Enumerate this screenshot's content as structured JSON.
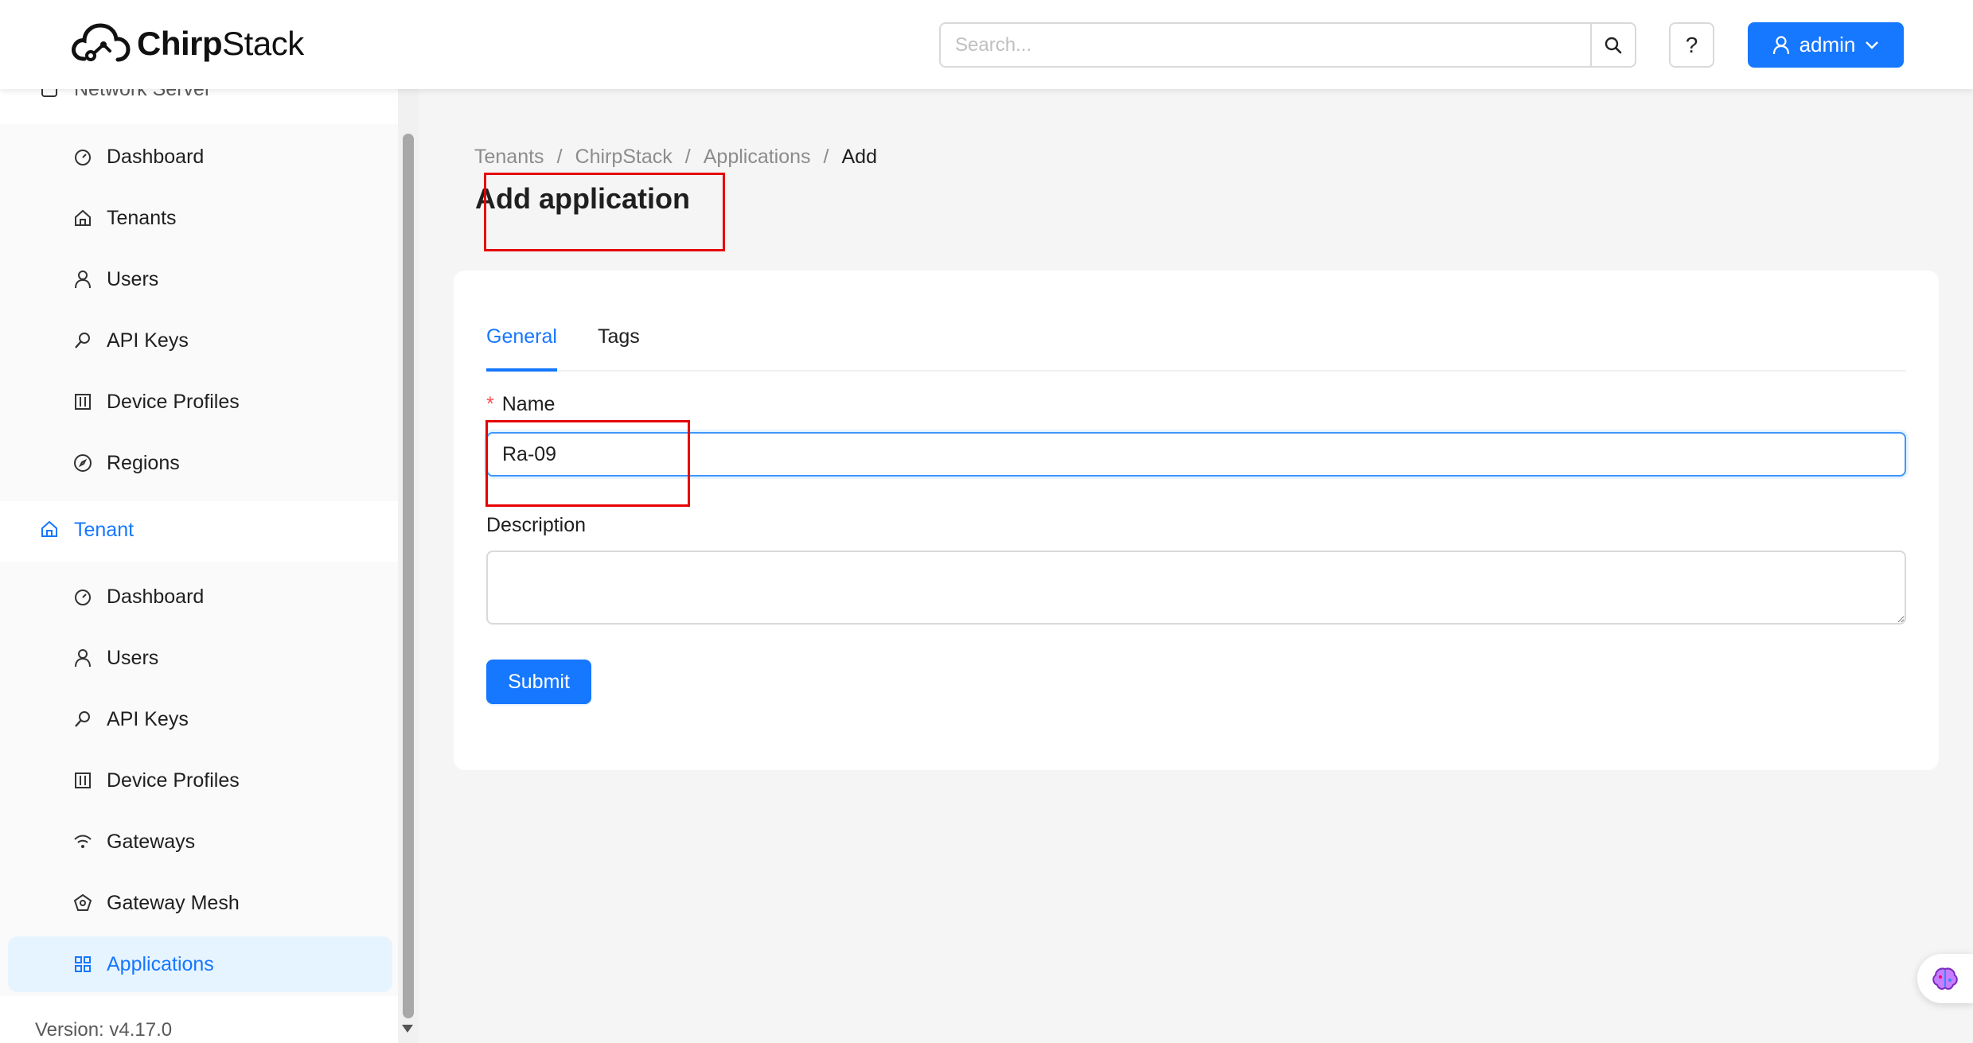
{
  "header": {
    "logo_bold": "Chirp",
    "logo_regular": "Stack",
    "search_placeholder": "Search...",
    "help_label": "?",
    "user_label": "admin"
  },
  "sidebar": {
    "network_server_label": "Network Server",
    "network_items": [
      {
        "label": "Dashboard",
        "icon": "dashboard-icon"
      },
      {
        "label": "Tenants",
        "icon": "home-icon"
      },
      {
        "label": "Users",
        "icon": "user-icon"
      },
      {
        "label": "API Keys",
        "icon": "key-icon"
      },
      {
        "label": "Device Profiles",
        "icon": "control-icon"
      },
      {
        "label": "Regions",
        "icon": "compass-icon"
      }
    ],
    "tenant_label": "Tenant",
    "tenant_items": [
      {
        "label": "Dashboard",
        "icon": "dashboard-icon"
      },
      {
        "label": "Users",
        "icon": "user-icon"
      },
      {
        "label": "API Keys",
        "icon": "key-icon"
      },
      {
        "label": "Device Profiles",
        "icon": "control-icon"
      },
      {
        "label": "Gateways",
        "icon": "wifi-icon"
      },
      {
        "label": "Gateway Mesh",
        "icon": "radar-icon"
      },
      {
        "label": "Applications",
        "icon": "appstore-icon",
        "selected": true
      }
    ],
    "version": "Version: v4.17.0"
  },
  "breadcrumb": [
    "Tenants",
    "ChirpStack",
    "Applications",
    "Add"
  ],
  "page_title": "Add application",
  "form": {
    "tabs": [
      "General",
      "Tags"
    ],
    "active_tab": "General",
    "name_label": "Name",
    "name_required_mark": "*",
    "name_value": "Ra-09",
    "description_label": "Description",
    "description_value": "",
    "submit_label": "Submit"
  },
  "colors": {
    "primary": "#1677ff",
    "annotation": "#e60000",
    "selected_bg": "#e6f4ff"
  }
}
